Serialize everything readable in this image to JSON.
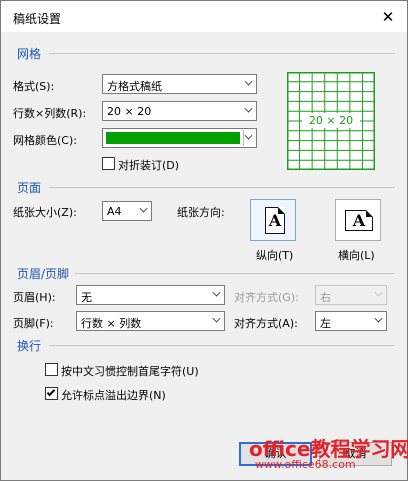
{
  "window": {
    "title": "稿纸设置",
    "close_glyph": "✕"
  },
  "grid_section": {
    "title": "网格",
    "format_label": "格式(S):",
    "format_value": "方格式稿纸",
    "rows_cols_label": "行数×列数(R):",
    "rows_cols_value": "20 × 20",
    "color_label": "网格颜色(C):",
    "color_value": "#00a000",
    "fold_label": "对折装订(D)",
    "fold_checked": false,
    "preview_text": "20 × 20",
    "preview_color": "#1e9e1e"
  },
  "page_section": {
    "title": "页面",
    "size_label": "纸张大小(Z):",
    "size_value": "A4",
    "orientation_label": "纸张方向:",
    "portrait_label": "纵向(T)",
    "landscape_label": "横向(L)",
    "icon_letter": "A",
    "selected": "portrait"
  },
  "header_footer_section": {
    "title": "页眉/页脚",
    "header_label": "页眉(H):",
    "header_value": "无",
    "header_align_label": "对齐方式(G):",
    "header_align_value": "右",
    "footer_label": "页脚(F):",
    "footer_value": "行数 × 列数",
    "footer_align_label": "对齐方式(A):",
    "footer_align_value": "左"
  },
  "line_break_section": {
    "title": "换行",
    "option1_label": "按中文习惯控制首尾字符(U)",
    "option1_checked": false,
    "option2_label": "允许标点溢出边界(N)",
    "option2_checked": true
  },
  "buttons": {
    "ok": "确认",
    "cancel": "取消"
  },
  "watermark": {
    "line1": "office教程学习网",
    "line2": "www.office68.com"
  }
}
